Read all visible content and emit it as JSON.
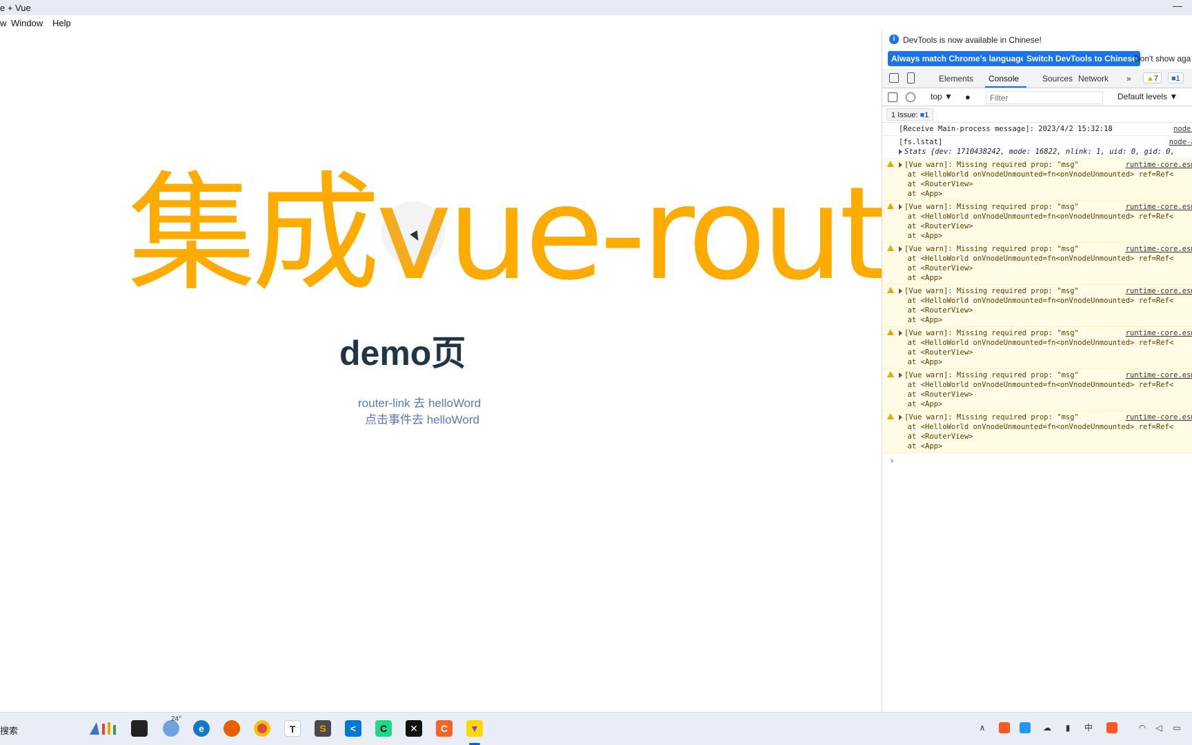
{
  "window": {
    "title": "e + Vue",
    "minimize": "—"
  },
  "menu": {
    "items": [
      "w",
      "Window",
      "Help"
    ]
  },
  "app": {
    "hero": "集成vue-router",
    "heading": "demo页",
    "link_router": "router-link 去 helloWord",
    "link_click": "点击事件去 helloWord"
  },
  "devtools": {
    "banner": "DevTools is now available in Chinese!",
    "buttons": [
      "Always match Chrome's language",
      "Switch DevTools to Chinese",
      "Don't show aga"
    ],
    "tabs": [
      "Elements",
      "Console",
      "Sources",
      "Network"
    ],
    "more": "»",
    "warn_count": "7",
    "info_count": "1",
    "context": "top ▼",
    "filter_placeholder": "Filter",
    "levels": "Default levels ▼",
    "issues": "1 Issue:",
    "issues_count": "1",
    "log1": "[Receive Main-process message]: 2023/4/2 15:32:18",
    "log1_src": "node-api.",
    "log2": "[fs.lstat]",
    "log2_src": "node-api.t",
    "log3": "Stats {dev: 1710438242, mode: 16822, nlink: 1, uid: 0, gid: 0,",
    "warn_lines": [
      "[Vue warn]: Missing required prop: \"msg\"",
      "at <HelloWorld onVnodeUnmounted=fn<onVnodeUnmounted> ref=Ref< ",
      "at <RouterView>",
      "at <App>"
    ],
    "warn_src": "runtime-core.esm-bun",
    "prompt": "›"
  },
  "taskbar": {
    "search": "搜索",
    "temperature": "24°"
  },
  "colors": {
    "hero": "#ffab00",
    "heading": "#213547",
    "link": "#5a78b5",
    "devtools_accent": "#1a73e8",
    "warn_bg": "#fffbe5"
  }
}
